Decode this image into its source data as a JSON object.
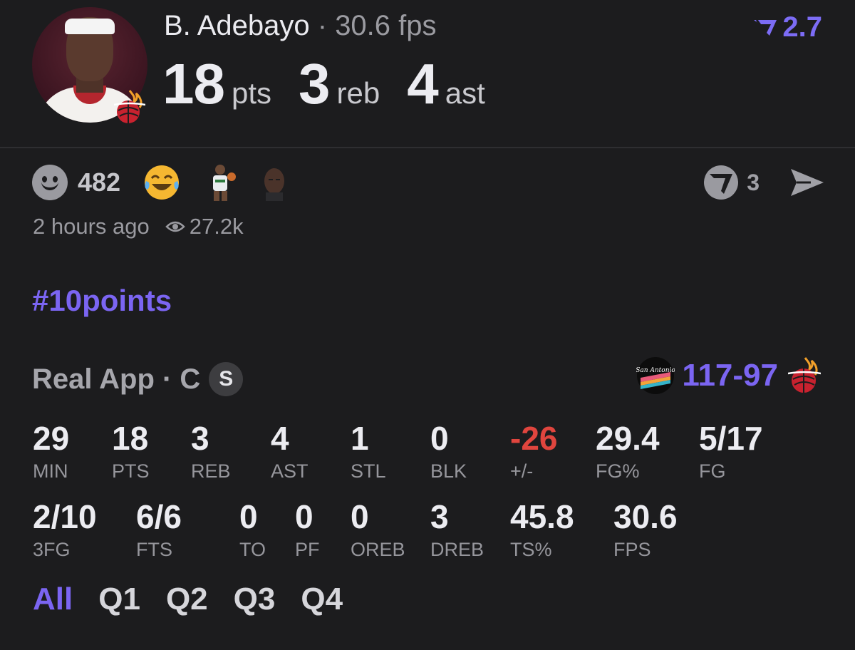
{
  "header": {
    "player_name": "B. Adebayo",
    "separator": "·",
    "fps_text": "30.6 fps",
    "rating": "2.7",
    "stats": [
      {
        "value": "18",
        "unit": "pts"
      },
      {
        "value": "3",
        "unit": "reb"
      },
      {
        "value": "4",
        "unit": "ast"
      }
    ]
  },
  "reactions": {
    "count": "482",
    "share_count": "3"
  },
  "meta": {
    "time_ago": "2 hours ago",
    "views": "27.2k"
  },
  "hashtag": "#10points",
  "game": {
    "source": "Real App · C",
    "badge": "S",
    "score_home": "117",
    "score_dash": "-",
    "score_away": "97",
    "opponent_logo_text": "San Antonio"
  },
  "box": {
    "row1": [
      {
        "value": "29",
        "label": "MIN"
      },
      {
        "value": "18",
        "label": "PTS"
      },
      {
        "value": "3",
        "label": "REB"
      },
      {
        "value": "4",
        "label": "AST"
      },
      {
        "value": "1",
        "label": "STL"
      },
      {
        "value": "0",
        "label": "BLK"
      },
      {
        "value": "-26",
        "label": "+/-"
      },
      {
        "value": "29.4",
        "label": "FG%"
      },
      {
        "value": "5/17",
        "label": "FG"
      }
    ],
    "row2": [
      {
        "value": "2/10",
        "label": "3FG"
      },
      {
        "value": "6/6",
        "label": "FTS"
      },
      {
        "value": "0",
        "label": "TO"
      },
      {
        "value": "0",
        "label": "PF"
      },
      {
        "value": "0",
        "label": "OREB"
      },
      {
        "value": "3",
        "label": "DREB"
      },
      {
        "value": "45.8",
        "label": "TS%"
      },
      {
        "value": "30.6",
        "label": "FPS"
      }
    ]
  },
  "periods": [
    "All",
    "Q1",
    "Q2",
    "Q3",
    "Q4"
  ],
  "colors": {
    "background": "#1c1c1e",
    "accent": "#7b65f2",
    "negative": "#e0453e"
  }
}
